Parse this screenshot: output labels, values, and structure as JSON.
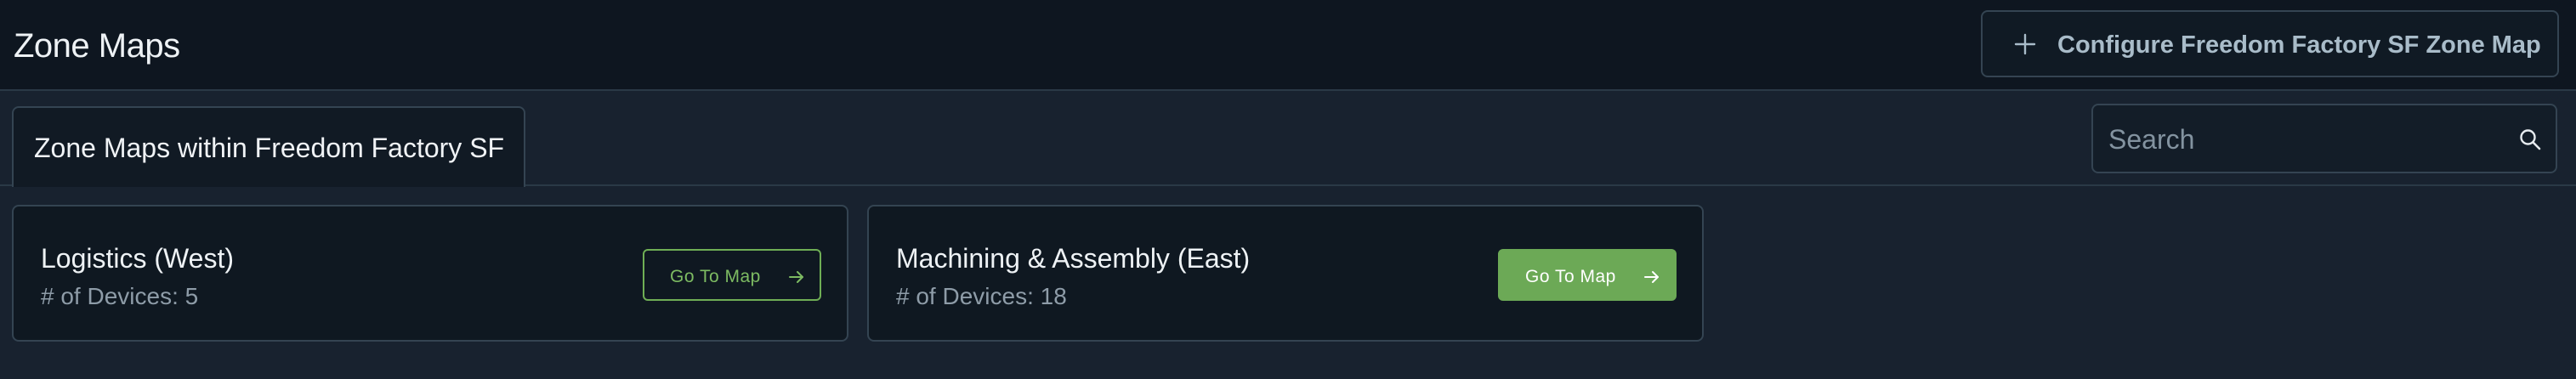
{
  "header": {
    "title": "Zone Maps",
    "configure_button": {
      "label": "Configure Freedom Factory SF Zone Map",
      "icon": "plus-icon"
    }
  },
  "tabs": [
    {
      "label": "Zone Maps within Freedom Factory SF",
      "active": true
    }
  ],
  "search": {
    "placeholder": "Search",
    "value": "",
    "icon": "search-icon"
  },
  "zones": [
    {
      "name": "Logistics (West)",
      "devices_label": "# of Devices: 5",
      "button_label": "Go To Map",
      "button_style": "outline",
      "button_icon": "arrow-right-icon"
    },
    {
      "name": "Machining & Assembly (East)",
      "devices_label": "# of Devices: 18",
      "button_label": "Go To Map",
      "button_style": "solid",
      "button_icon": "arrow-right-icon"
    }
  ],
  "colors": {
    "background": "#18222f",
    "topbar": "#0e1620",
    "card": "#0f1821",
    "border": "#344452",
    "accent_green": "#6ca956",
    "configure_text": "#a9bcc9"
  }
}
